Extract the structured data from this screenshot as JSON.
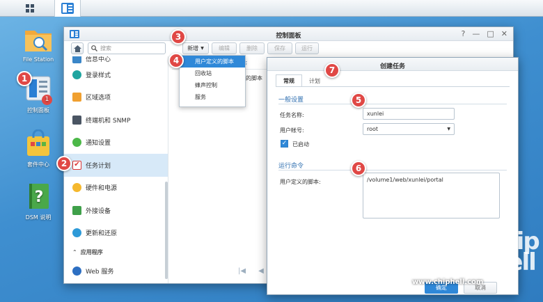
{
  "desktop": {
    "icons": [
      {
        "label": "File Station"
      },
      {
        "label": "控制面板",
        "badge": "1"
      },
      {
        "label": "套件中心"
      },
      {
        "label": "DSM 说明"
      }
    ]
  },
  "window": {
    "title": "控制面板",
    "controls": [
      "?",
      "—",
      "□",
      "✕"
    ],
    "search_placeholder": "搜索",
    "toolbar": {
      "new": "新增",
      "edit": "编辑",
      "delete": "删除",
      "save": "保存",
      "run": "运行"
    },
    "sidebar": {
      "items": [
        {
          "label": "信息中心"
        },
        {
          "label": "登录样式"
        },
        {
          "label": "区域选项"
        },
        {
          "label": "终端机和 SNMP"
        },
        {
          "label": "通知设置"
        },
        {
          "label": "任务计划"
        },
        {
          "label": "硬件和电源"
        },
        {
          "label": "外接设备"
        },
        {
          "label": "更新和还原"
        }
      ],
      "section": "应用程序",
      "section_items": [
        {
          "label": "Web 服务"
        }
      ]
    },
    "content": {
      "header_fragment": "序",
      "row_fragment": "义的脚本",
      "pager": [
        "|◀",
        "◀",
        "▶",
        "▶|"
      ]
    }
  },
  "menu": {
    "items": [
      {
        "label": "用户定义的脚本"
      },
      {
        "label": "回收站"
      },
      {
        "label": "蜂声控制"
      },
      {
        "label": "服务"
      }
    ]
  },
  "dialog": {
    "title": "创建任务",
    "tabs": [
      {
        "label": "常规"
      },
      {
        "label": "计划"
      }
    ],
    "general": {
      "heading": "一般设置",
      "task_name_label": "任务名称:",
      "task_name_value": "xunlei",
      "user_label": "用户帐号:",
      "user_value": "root",
      "enabled_label": "已启动"
    },
    "run": {
      "heading": "运行命令",
      "script_label": "用户定义的脚本:",
      "script_value": "/volume1/web/xunlei/portal"
    },
    "ok_label": "确定",
    "cancel_label": "取消"
  },
  "markers": [
    "1",
    "2",
    "3",
    "4",
    "5",
    "6",
    "7"
  ],
  "watermark": {
    "url": "www.chiphell.com",
    "logo_text": "chip hell"
  }
}
